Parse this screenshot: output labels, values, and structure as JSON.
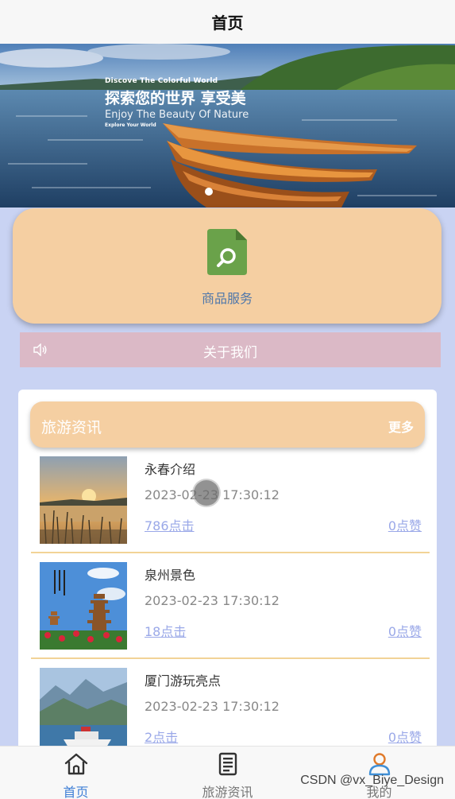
{
  "header": {
    "title": "首页"
  },
  "banner": {
    "small_text": "Discove The Colorful World",
    "main_text": "探索您的世界 享受美",
    "sub_text": "Enjoy The Beauty Of Nature",
    "tiny_text": "Explore Your World"
  },
  "service": {
    "label": "商品服务",
    "icon": "search-document-icon"
  },
  "about": {
    "label": "关于我们",
    "icon": "speaker-icon"
  },
  "news": {
    "title": "旅游资讯",
    "more": "更多",
    "items": [
      {
        "title": "永春介绍",
        "time": "2023-02-23 17:30:12",
        "clicks": "786点击",
        "likes": "0点赞"
      },
      {
        "title": "泉州景色",
        "time": "2023-02-23 17:30:12",
        "clicks": "18点击",
        "likes": "0点赞"
      },
      {
        "title": "厦门游玩亮点",
        "time": "2023-02-23 17:30:12",
        "clicks": "2点击",
        "likes": "0点赞"
      }
    ]
  },
  "tabbar": {
    "items": [
      {
        "label": "首页",
        "icon": "home-icon",
        "active": true
      },
      {
        "label": "旅游资讯",
        "icon": "document-icon",
        "active": false
      },
      {
        "label": "我的",
        "icon": "user-icon",
        "active": false
      }
    ]
  },
  "watermark": "CSDN @vx_Biye_Design",
  "colors": {
    "accent": "#3f7fd6",
    "card": "#f5cfa2",
    "background": "#c9d3f3",
    "about_bar": "#dbb9c6",
    "link": "#9aa8e8"
  }
}
